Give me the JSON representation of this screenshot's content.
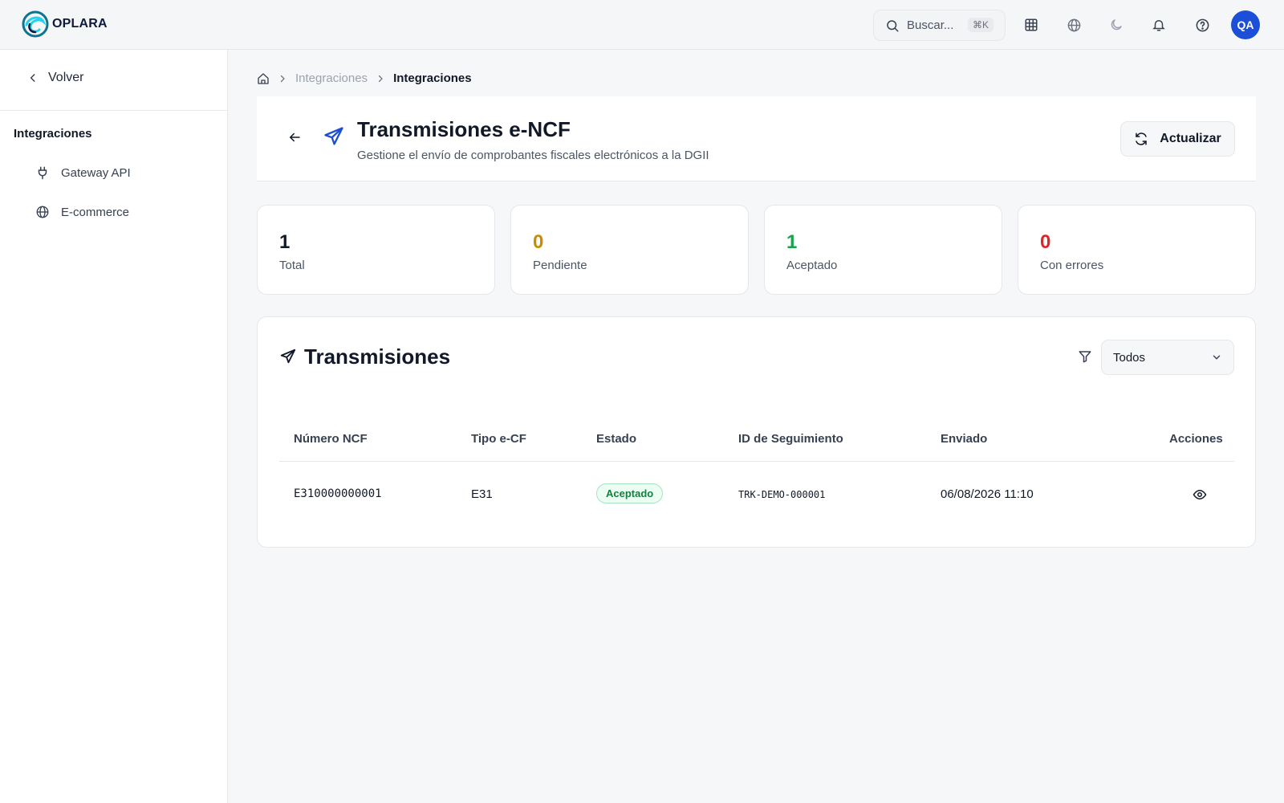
{
  "app": {
    "brand": "OPLARA",
    "search_placeholder": "Buscar...",
    "search_shortcut": "⌘K",
    "user_initials": "QA",
    "accent_color": "#1d4ed8"
  },
  "sidebar": {
    "back_label": "Volver",
    "section_title": "Integraciones",
    "items": [
      {
        "label": "Gateway API",
        "icon": "plug-icon"
      },
      {
        "label": "E-commerce",
        "icon": "globe-icon"
      }
    ]
  },
  "breadcrumb": [
    "Integraciones",
    "Integraciones"
  ],
  "header": {
    "title": "Transmisiones e-NCF",
    "subtitle": "Gestione el envío de comprobantes fiscales electrónicos a la DGII",
    "refresh_label": "Actualizar"
  },
  "stats": [
    {
      "value": "1",
      "label": "Total",
      "color": "#111827"
    },
    {
      "value": "0",
      "label": "Pendiente",
      "color": "#ca8a04"
    },
    {
      "value": "1",
      "label": "Aceptado",
      "color": "#16a34a"
    },
    {
      "value": "0",
      "label": "Con errores",
      "color": "#dc2626"
    }
  ],
  "table": {
    "title": "Transmisiones",
    "filter_value": "Todos",
    "columns": [
      "Número NCF",
      "Tipo e-CF",
      "Estado",
      "ID de Seguimiento",
      "Enviado",
      "Acciones"
    ],
    "rows": [
      {
        "ncf": "E310000000001",
        "tipo": "E31",
        "estado": "Aceptado",
        "seguimiento": "TRK-DEMO-000001",
        "enviado": "06/08/2026 11:10"
      }
    ]
  }
}
